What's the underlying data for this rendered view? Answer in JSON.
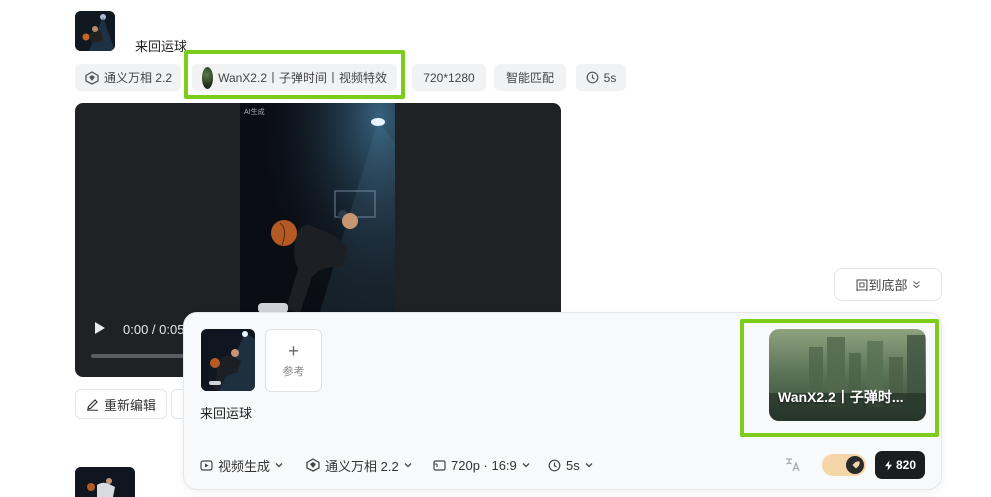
{
  "message": {
    "prompt": "来回运球",
    "chips": [
      {
        "label": "通义万相 2.2",
        "icon": "tongyi-logo-icon"
      },
      {
        "label": "WanX2.2丨子弹时间丨视频特效",
        "icon": "effect-thumb"
      },
      {
        "label": "720*1280"
      },
      {
        "label": "智能匹配"
      },
      {
        "label": "5s",
        "icon": "clock-icon"
      }
    ],
    "video": {
      "time": "0:00 / 0:05",
      "watermark": "AI生成"
    },
    "actions": {
      "reedit_label": "重新编辑"
    }
  },
  "back_to_bottom": {
    "label": "回到底部"
  },
  "composer": {
    "ref_add_label": "参考",
    "prompt_text": "来回运球",
    "effect_card_title": "WanX2.2丨子弹时...",
    "toolbar": {
      "mode": "视频生成",
      "model": "通义万相 2.2",
      "resolution": "720p · 16:9",
      "duration": "5s",
      "credits": "820"
    }
  },
  "colors": {
    "highlight": "#7ccc1a",
    "toggle_bg": "#f5d6a8",
    "credits_bg": "#1b1d21"
  }
}
